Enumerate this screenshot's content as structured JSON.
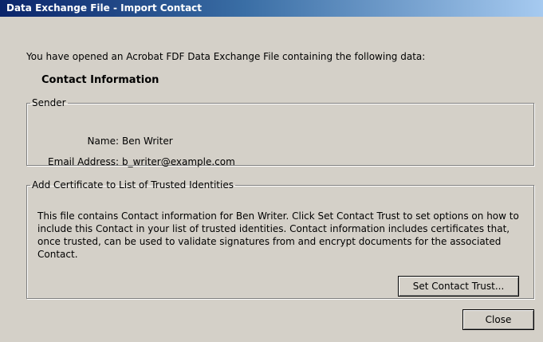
{
  "window": {
    "title": "Data Exchange File - Import Contact"
  },
  "intro": {
    "text": "You have opened an Acrobat FDF Data Exchange File containing the following data:"
  },
  "section": {
    "heading": "Contact Information"
  },
  "sender": {
    "legend": "Sender",
    "name_label": "Name:",
    "name_value": "Ben Writer",
    "email_label": "Email Address:",
    "email_value": "b_writer@example.com"
  },
  "certificate": {
    "legend": "Add Certificate to List of Trusted Identities",
    "description": "This file contains Contact information for Ben Writer. Click Set Contact Trust to set options on how to include this Contact in your list of trusted identities. Contact information includes certificates that, once trusted, can be used to validate signatures from and encrypt documents for the associated Contact.",
    "set_trust_label": "Set Contact Trust..."
  },
  "footer": {
    "close_label": "Close"
  },
  "colors": {
    "dialog_background": "#d4d0c8",
    "titlebar_start": "#0a246a",
    "titlebar_end": "#a6caf0",
    "titlebar_text": "#ffffff"
  }
}
